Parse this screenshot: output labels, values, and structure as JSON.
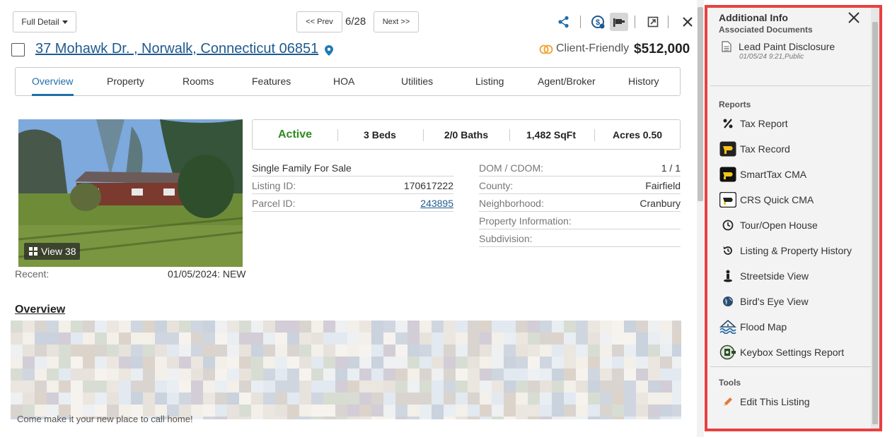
{
  "toolbar": {
    "view_select": "Full Detail",
    "prev_label": "<< Prev",
    "counter": "6/28",
    "next_label": "Next >>"
  },
  "listing": {
    "address": "37 Mohawk Dr. , Norwalk, Connecticut 06851",
    "client_friendly_label": "Client-Friendly",
    "price": "$512,000"
  },
  "tabs": [
    "Overview",
    "Property",
    "Rooms",
    "Features",
    "HOA",
    "Utilities",
    "Listing",
    "Agent/Broker",
    "History"
  ],
  "active_tab": "Overview",
  "photo": {
    "view_label": "View 38"
  },
  "recent": {
    "label": "Recent:",
    "value": "01/05/2024: NEW"
  },
  "stats": {
    "status": "Active",
    "beds": "3 Beds",
    "baths": "2/0 Baths",
    "sqft": "1,482 SqFt",
    "acres": "Acres 0.50"
  },
  "details_left": [
    {
      "label": "Single Family For Sale",
      "value": ""
    },
    {
      "label": "Listing ID:",
      "value": "170617222"
    },
    {
      "label": "Parcel ID:",
      "value": "243895"
    }
  ],
  "details_right": [
    {
      "label": "DOM / CDOM:",
      "value": "1 / 1"
    },
    {
      "label": "County:",
      "value": "Fairfield"
    },
    {
      "label": "Neighborhood:",
      "value": "Cranbury"
    },
    {
      "label": "Property Information:",
      "value": ""
    },
    {
      "label": "Subdivision:",
      "value": ""
    }
  ],
  "overview": {
    "heading": "Overview",
    "tail_text": "Come make it your new place to call home!"
  },
  "side_panel": {
    "title": "Additional Info",
    "docs_heading": "Associated Documents",
    "doc": {
      "name": "Lead Paint Disclosure",
      "meta": "01/05/24 9:21,Public"
    },
    "reports_heading": "Reports",
    "reports": [
      {
        "label": "Tax Report",
        "icon": "percent-icon"
      },
      {
        "label": "Tax Record",
        "icon": "tax-record-icon"
      },
      {
        "label": "SmartTax CMA",
        "icon": "smarttax-icon"
      },
      {
        "label": "CRS Quick CMA",
        "icon": "crs-icon"
      },
      {
        "label": "Tour/Open House",
        "icon": "clock-icon"
      },
      {
        "label": "Listing & Property History",
        "icon": "history-icon"
      },
      {
        "label": "Streetside View",
        "icon": "streetside-icon"
      },
      {
        "label": "Bird's Eye View",
        "icon": "globe-icon"
      },
      {
        "label": "Flood Map",
        "icon": "flood-icon"
      },
      {
        "label": "Keybox Settings Report",
        "icon": "keybox-icon"
      }
    ],
    "tools_heading": "Tools",
    "tools": [
      {
        "label": "Edit This Listing",
        "icon": "pencil-icon"
      }
    ]
  },
  "colors": {
    "link": "#1f5a8f",
    "active_tab": "#1f6ea8",
    "status_active": "#2e8b1f",
    "panel_border": "#e8403f"
  }
}
